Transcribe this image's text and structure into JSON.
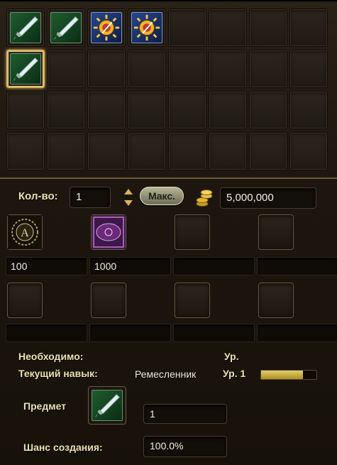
{
  "inventory": {
    "slots": [
      {
        "icon": "sword-icon",
        "kind": "green"
      },
      {
        "icon": "sword-icon",
        "kind": "green"
      },
      {
        "icon": "sun-scroll-icon",
        "kind": "blue"
      },
      {
        "icon": "sun-scroll-icon",
        "kind": "blue"
      },
      {},
      {},
      {},
      {},
      {
        "icon": "sword-icon",
        "kind": "green",
        "selected": true
      },
      {},
      {},
      {},
      {},
      {},
      {},
      {},
      {},
      {},
      {},
      {},
      {},
      {},
      {},
      {},
      {},
      {},
      {},
      {},
      {},
      {},
      {},
      {}
    ]
  },
  "controls": {
    "quantity_label": "Кол-во:",
    "quantity_value": "1",
    "max_label": "Макс.",
    "cost_value": "5,000,000"
  },
  "materials": {
    "row1": [
      {
        "icon": "rune-a-icon",
        "amount": "100"
      },
      {
        "icon": "purple-seal-icon",
        "amount": "1000"
      },
      {
        "icon": "",
        "amount": ""
      },
      {
        "icon": "",
        "amount": ""
      }
    ],
    "row2": [
      {
        "icon": "",
        "amount": ""
      },
      {
        "icon": "",
        "amount": ""
      },
      {
        "icon": "",
        "amount": ""
      },
      {
        "icon": "",
        "amount": ""
      }
    ]
  },
  "info": {
    "required_label": "Необходимо:",
    "level_header": "Ур.",
    "skill_label": "Текущий навык:",
    "skill_name": "Ремесленник",
    "skill_level": "Ур. 1",
    "skill_progress": 0.75,
    "item_label": "Предмет",
    "item_icon": "sword-icon",
    "item_count": "1",
    "chance_label": "Шанс создания:",
    "chance_value": "100.0%"
  },
  "colors": {
    "accent_gold": "#d7b05c",
    "bar_fill": "#d8c14d"
  }
}
